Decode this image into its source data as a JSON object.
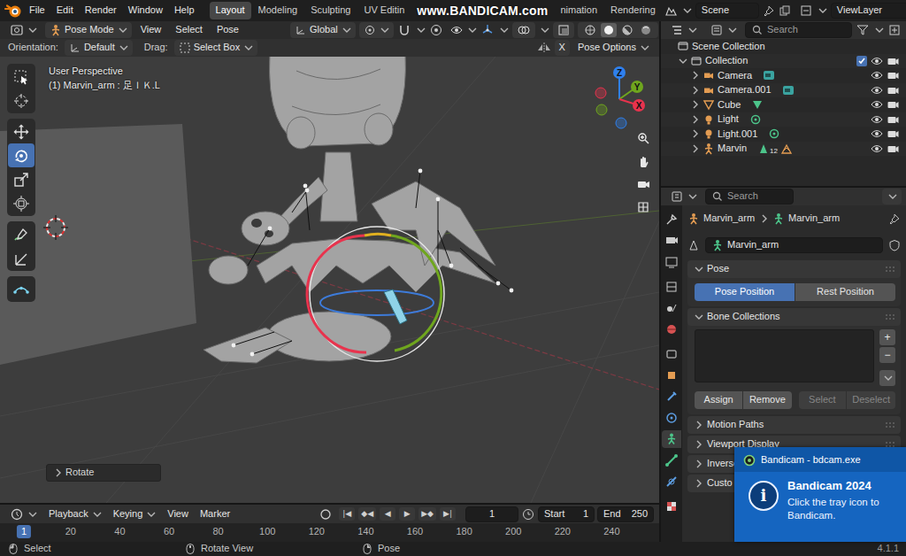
{
  "topbar": {
    "menus": [
      "File",
      "Edit",
      "Render",
      "Window",
      "Help"
    ],
    "workspaces": [
      {
        "label": "Layout",
        "selected": true
      },
      {
        "label": "Modeling",
        "selected": false
      },
      {
        "label": "Sculpting",
        "selected": false
      },
      {
        "label": "UV Editin",
        "selected": false
      }
    ],
    "watermark": "www.BANDICAM.com",
    "workspaces_after": [
      {
        "label": "nimation",
        "selected": false
      },
      {
        "label": "Rendering",
        "selected": false
      }
    ],
    "scene": "Scene",
    "view_layer": "ViewLayer"
  },
  "viewport": {
    "mode": "Pose Mode",
    "menus": [
      "View",
      "Select",
      "Pose"
    ],
    "transform_orientation": "Global",
    "shading": [
      {
        "selected": false
      },
      {
        "selected": true
      },
      {
        "selected": false
      },
      {
        "selected": false
      }
    ],
    "orientation_label": "Orientation:",
    "orientation": "Default",
    "drag_label": "Drag:",
    "drag": "Select Box",
    "mirror_button": "X",
    "pose_options": "Pose Options",
    "info": [
      "User Perspective",
      "(1) Marvin_arm : 足ＩＫ.L"
    ],
    "axes": [
      {
        "label": "Z",
        "color": "#2f80ed"
      },
      {
        "label": "Y",
        "color": "#6fa61e"
      },
      {
        "label": "X",
        "color": "#e8334d"
      }
    ],
    "tools": [
      {
        "selected": false
      },
      {
        "selected": false
      },
      {
        "selected": false
      },
      {
        "selected": true
      },
      {
        "selected": false
      },
      {
        "selected": false
      },
      {
        "selected": false
      },
      {
        "selected": false
      },
      {
        "selected": false
      }
    ],
    "last_operator": {
      "label": "Rotate",
      "expanded": false
    }
  },
  "timeline": {
    "menus": [
      {
        "label": "Playback",
        "dropdown": true
      },
      {
        "label": "Keying",
        "dropdown": true
      },
      {
        "label": "View",
        "dropdown": false
      },
      {
        "label": "Marker",
        "dropdown": false
      }
    ],
    "transport": [
      "|◀",
      "◆◀",
      "◀",
      "▶",
      "▶◆",
      "▶|"
    ],
    "current_frame": "1",
    "start_label": "Start",
    "start": "1",
    "end_label": "End",
    "end": "250",
    "ruler": {
      "current": "1",
      "ticks": [
        "20",
        "40",
        "60",
        "80",
        "100",
        "120",
        "140",
        "160",
        "180",
        "200",
        "220",
        "240"
      ]
    }
  },
  "outliner": {
    "search_placeholder": "Search",
    "scene_collection": "Scene Collection",
    "collection": {
      "label": "Collection",
      "checked": true,
      "expanded": true,
      "visible": true,
      "render": true
    },
    "items": [
      {
        "label": "Camera",
        "kind": "camera",
        "visible": true,
        "render": true
      },
      {
        "label": "Camera.001",
        "kind": "camera",
        "visible": true,
        "render": true
      },
      {
        "label": "Cube",
        "kind": "mesh",
        "visible": true,
        "render": true
      },
      {
        "label": "Light",
        "kind": "light",
        "visible": true,
        "render": true
      },
      {
        "label": "Light.001",
        "kind": "light",
        "visible": true,
        "render": true
      },
      {
        "label": "Marvin",
        "kind": "armature",
        "badge": "12",
        "visible": true,
        "render": true
      }
    ]
  },
  "properties": {
    "search_placeholder": "Search",
    "tabs": [
      {
        "selected": false
      },
      {
        "selected": false
      },
      {
        "selected": false
      },
      {
        "selected": false
      },
      {
        "selected": false
      },
      {
        "selected": false
      },
      {
        "selected": false
      },
      {
        "selected": false
      },
      {
        "selected": false
      },
      {
        "selected": false
      },
      {
        "selected": true
      },
      {
        "selected": false
      },
      {
        "selected": false
      },
      {
        "selected": false
      }
    ],
    "breadcrumb": [
      "Marvin_arm",
      "Marvin_arm"
    ],
    "name": "Marvin_arm",
    "pose_panel": {
      "title": "Pose",
      "expanded": true,
      "options": [
        {
          "label": "Pose Position",
          "selected": true
        },
        {
          "label": "Rest Position",
          "selected": false
        }
      ]
    },
    "bone_collections": {
      "title": "Bone Collections",
      "expanded": true,
      "side_buttons": [
        "+",
        "−"
      ],
      "actions": [
        {
          "label": "Assign",
          "disabled": false
        },
        {
          "label": "Remove",
          "disabled": false
        },
        {
          "label": "Select",
          "disabled": true
        },
        {
          "label": "Deselect",
          "disabled": true
        }
      ]
    },
    "closed_panels": [
      {
        "title": "Motion Paths",
        "expanded": false
      },
      {
        "title": "Viewport Display",
        "expanded": false
      },
      {
        "title": "Inverse",
        "expanded": false
      },
      {
        "title": "Custo",
        "expanded": false
      }
    ]
  },
  "status_bar": {
    "items": [
      {
        "label": "Select"
      },
      {
        "label": "Rotate View"
      },
      {
        "label": "Pose"
      }
    ],
    "version": "4.1.1"
  },
  "notification": {
    "app": "Bandicam - bdcam.exe",
    "icon": "i",
    "title": "Bandicam 2024",
    "lines": [
      "Click the tray icon to",
      "Bandicam."
    ]
  }
}
